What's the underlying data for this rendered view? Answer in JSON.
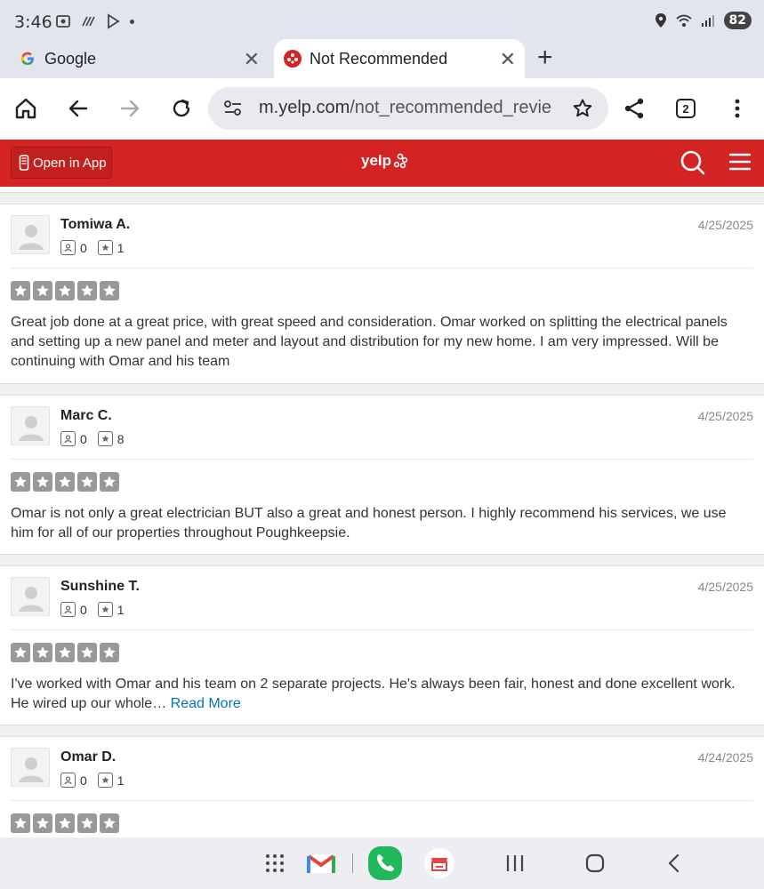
{
  "status": {
    "time": "3:46",
    "battery": "82"
  },
  "tabs": [
    {
      "title": "Google",
      "active": false
    },
    {
      "title": "Not Recommended",
      "active": true
    }
  ],
  "toolbar": {
    "url_host": "m.yelp.com",
    "url_path": "/not_recommended_revie",
    "tab_count": "2"
  },
  "yelp": {
    "open_in_app": "Open in App",
    "logo": "yelp"
  },
  "reviews": [
    {
      "name": "Tomiwa A.",
      "date": "4/25/2025",
      "friends": "0",
      "reviews": "1",
      "rating": 5,
      "text": "Great job done at a great price, with great speed and consideration. Omar worked on splitting the electrical panels and setting up a new panel and meter and layout and distribution for my new home. I am very impressed. Will be continuing with Omar and his team",
      "read_more": ""
    },
    {
      "name": "Marc C.",
      "date": "4/25/2025",
      "friends": "0",
      "reviews": "8",
      "rating": 5,
      "text": "Omar is not only a great electrician BUT also a great and honest person. I highly recommend his services, we use him for all of our properties throughout Poughkeepsie.",
      "read_more": ""
    },
    {
      "name": "Sunshine T.",
      "date": "4/25/2025",
      "friends": "0",
      "reviews": "1",
      "rating": 5,
      "text": "I've worked with Omar and his team on 2 separate projects.  He's always been fair, honest and done excellent work.  He wired up our whole…",
      "read_more": "Read More"
    },
    {
      "name": "Omar D.",
      "date": "4/24/2025",
      "friends": "0",
      "reviews": "1",
      "rating": 5,
      "text": "",
      "read_more": ""
    }
  ],
  "colors": {
    "yelp_red": "#d32323",
    "star_gray": "#999999",
    "link_blue": "#0073bb"
  },
  "nav": {
    "icons": [
      "apps-grid-icon",
      "gmail-icon",
      "phone-icon",
      "store-icon",
      "recents-icon",
      "home-icon",
      "back-icon"
    ]
  }
}
